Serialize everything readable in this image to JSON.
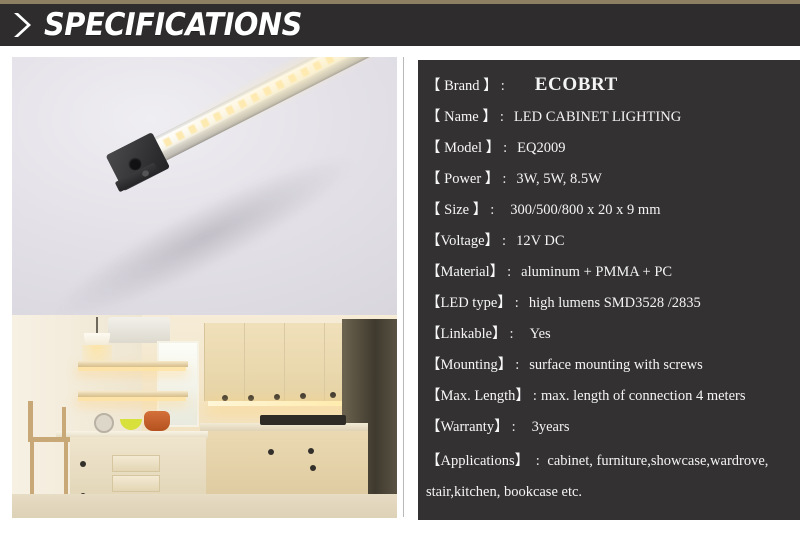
{
  "header": {
    "title": "SPECIFICATIONS",
    "arrow_icon": "chevron-right-icon",
    "bar_color": "#2e2c2c",
    "strip_color": "#8d7f62"
  },
  "media": {
    "product_photo": "led-bar-light-product-photo",
    "application_photo": "kitchen-under-cabinet-lighting-photo"
  },
  "spec_panel": {
    "background_color": "#333132",
    "text_color": "#f4f4f4",
    "colon": ":",
    "rows": [
      {
        "label": "【 Brand 】",
        "value": "ECOBRT"
      },
      {
        "label": "【 Name 】",
        "value": "LED CABINET LIGHTING"
      },
      {
        "label": "【 Model 】",
        "value": "EQ2009"
      },
      {
        "label": "【 Power 】",
        "value": "3W, 5W, 8.5W"
      },
      {
        "label": "【 Size 】",
        "value": "300/500/800 x 20 x 9 mm"
      },
      {
        "label": "【Voltage】",
        "value": "12V DC"
      },
      {
        "label": "【Material】",
        "value": "aluminum + PMMA + PC"
      },
      {
        "label": "【LED type】",
        "value": "high lumens SMD3528 /2835"
      },
      {
        "label": "【Linkable】",
        "value": "Yes"
      },
      {
        "label": "【Mounting】",
        "value": "surface mounting with screws"
      },
      {
        "label": "【Max. Length】",
        "value": "max. length of connection 4 meters"
      },
      {
        "label": "【Warranty】",
        "value": "3years"
      },
      {
        "label": "【Applications】",
        "value": "cabinet, furniture,showcase,wardrove, stair,kitchen, bookcase etc."
      }
    ]
  }
}
